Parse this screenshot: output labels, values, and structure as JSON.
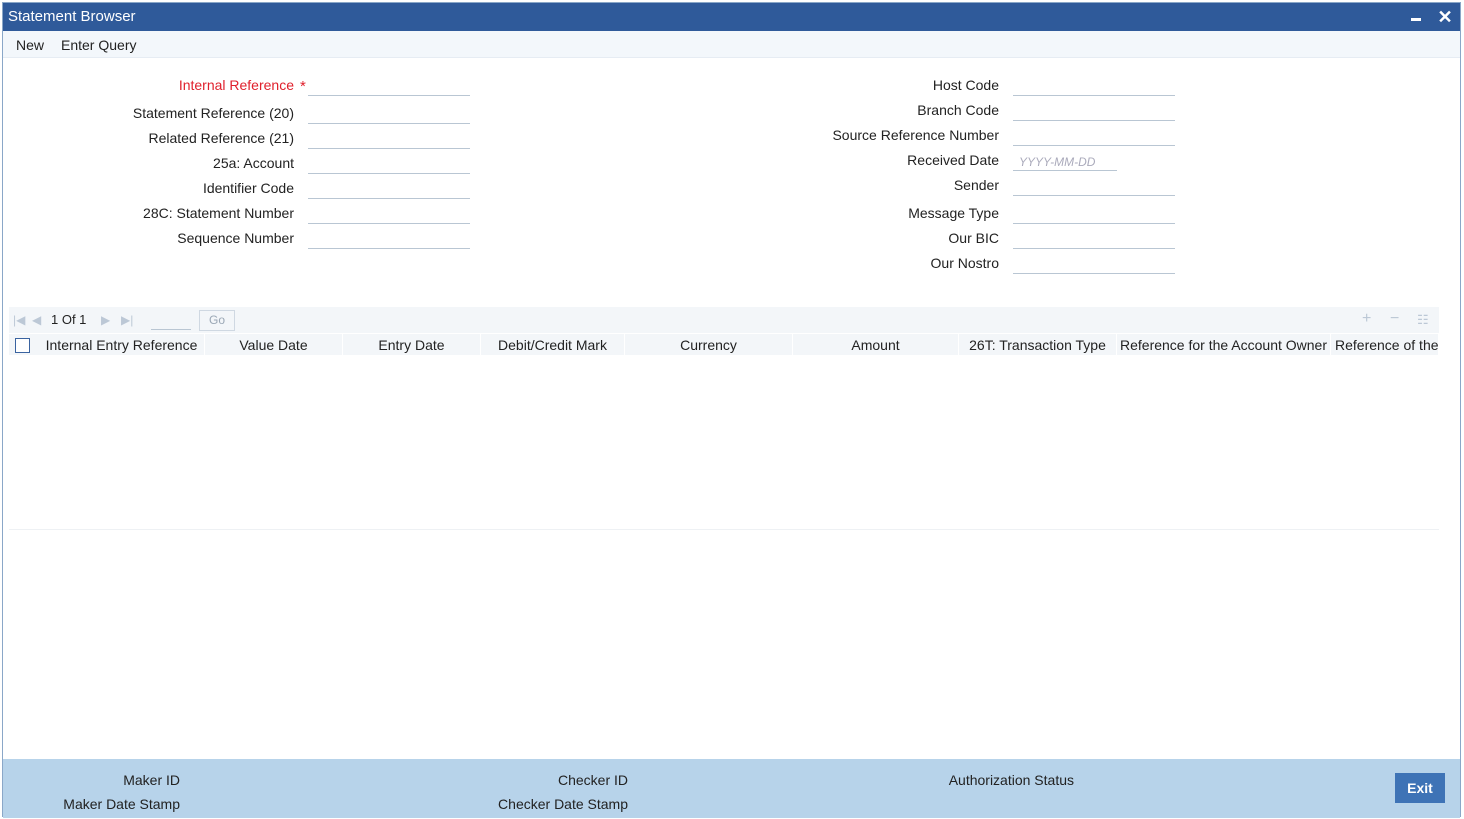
{
  "window": {
    "title": "Statement Browser"
  },
  "toolbar": {
    "new_label": "New",
    "enter_query_label": "Enter Query"
  },
  "form": {
    "left": [
      {
        "label": "Internal Reference",
        "required": true,
        "value": ""
      },
      {
        "label": "Statement Reference (20)",
        "value": ""
      },
      {
        "label": "Related Reference (21)",
        "value": ""
      },
      {
        "label": "25a: Account",
        "value": ""
      },
      {
        "label": "Identifier Code",
        "value": ""
      },
      {
        "label": "28C: Statement Number",
        "value": ""
      },
      {
        "label": "Sequence Number",
        "value": ""
      }
    ],
    "required_marker": "*",
    "right": [
      {
        "label": "Host Code",
        "value": ""
      },
      {
        "label": "Branch Code",
        "value": ""
      },
      {
        "label": "Source Reference Number",
        "value": ""
      },
      {
        "label": "Received Date",
        "value": "",
        "placeholder": "YYYY-MM-DD"
      },
      {
        "label": "Sender",
        "value": ""
      },
      {
        "label": "Message Type",
        "value": ""
      },
      {
        "label": "Our BIC",
        "value": ""
      },
      {
        "label": "Our Nostro",
        "value": ""
      }
    ]
  },
  "grid": {
    "pager_text": "1 Of 1",
    "go_label": "Go",
    "columns": [
      "Internal Entry Reference",
      "Value Date",
      "Entry Date",
      "Debit/Credit Mark",
      "Currency",
      "Amount",
      "26T: Transaction Type",
      "Reference for the Account Owner",
      "Reference of the A"
    ],
    "rows": []
  },
  "footer": {
    "maker_id_label": "Maker ID",
    "maker_date_label": "Maker Date Stamp",
    "checker_id_label": "Checker ID",
    "checker_date_label": "Checker Date Stamp",
    "auth_status_label": "Authorization Status",
    "exit_label": "Exit"
  },
  "colors": {
    "titlebar": "#2f5a9a",
    "required": "#e0202c",
    "footer": "#b7d3ea",
    "exit_button": "#3e73b6"
  }
}
